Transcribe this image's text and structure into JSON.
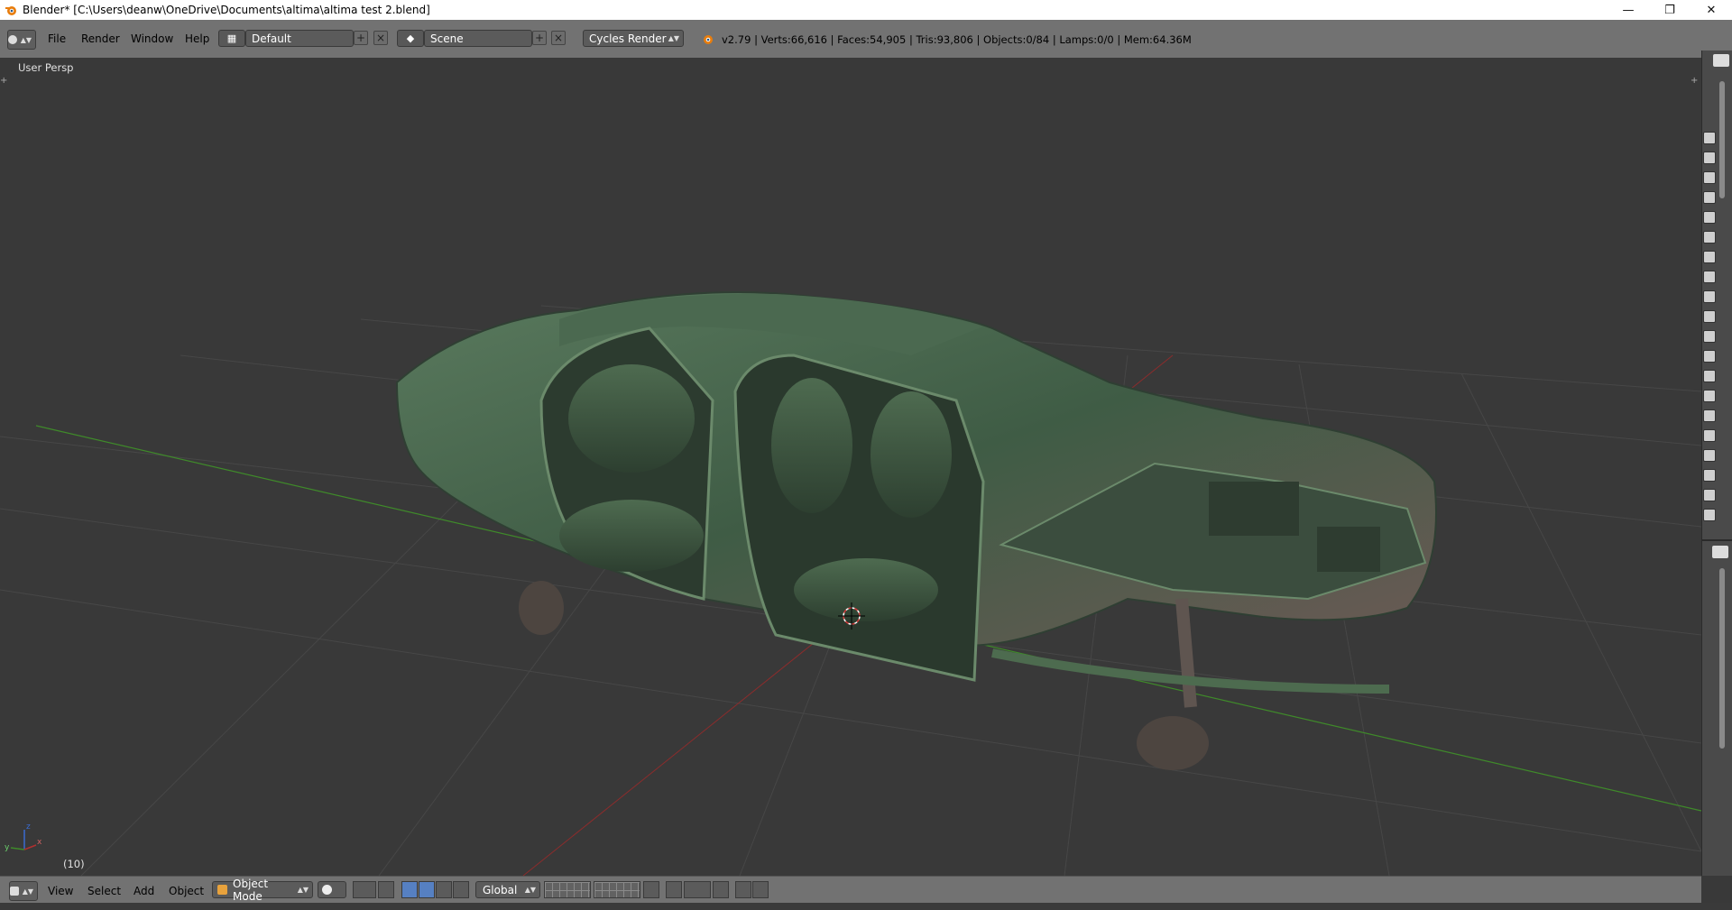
{
  "window": {
    "title": "Blender* [C:\\Users\\deanw\\OneDrive\\Documents\\altima\\altima test 2.blend]",
    "controls": [
      "minimize-icon",
      "restore-icon",
      "close-icon"
    ]
  },
  "info_header": {
    "menus": [
      "File",
      "Render",
      "Window",
      "Help"
    ],
    "screen_layout": "Default",
    "scene": "Scene",
    "render_engine": "Cycles Render",
    "stats": "v2.79 | Verts:66,616 | Faces:54,905 | Tris:93,806 | Objects:0/84 | Lamps:0/0 | Mem:64.36M"
  },
  "viewport": {
    "view_label": "User Persp",
    "frame": "(10)",
    "axes": [
      "x",
      "y",
      "z"
    ],
    "colors": {
      "background": "#393939",
      "x_axis": "#8c2c2c",
      "y_axis": "#3f8a2a",
      "model": "#4d6b4f"
    }
  },
  "footer": {
    "menus": [
      "View",
      "Select",
      "Add",
      "Object"
    ],
    "mode": "Object Mode",
    "orientation": "Global"
  }
}
